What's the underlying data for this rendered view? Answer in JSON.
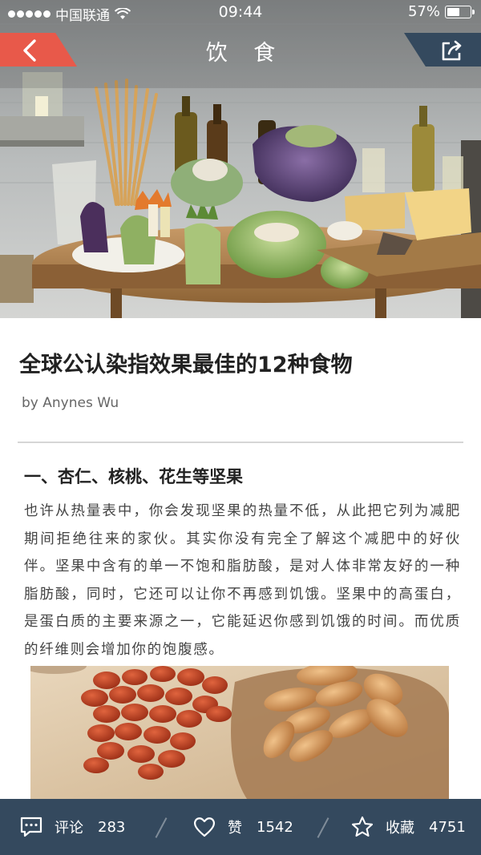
{
  "status_bar": {
    "carrier": "中国联通",
    "time": "09:44",
    "battery_percent": "57%",
    "battery_level": 0.57
  },
  "nav": {
    "title": "饮 食",
    "back_icon": "chevron-left-icon",
    "share_icon": "share-icon",
    "back_color": "#e8594a",
    "share_color": "#34495e"
  },
  "article": {
    "title": "全球公认染指效果最佳的12种食物",
    "author": "by Anynes Wu",
    "section_heading": "一、杏仁、核桃、花生等坚果",
    "body": "也许从热量表中，你会发现坚果的热量不低，从此把它列为减肥期间拒绝往来的家伙。其实你没有完全了解这个减肥中的好伙伴。坚果中含有的单一不饱和脂肪酸，是对人体非常友好的一种脂肪酸，同时，它还可以让你不再感到饥饿。坚果中的高蛋白，是蛋白质的主要来源之一，它能延迟你感到饥饿的时间。而优质的纤维则会增加你的饱腹感。"
  },
  "bottom_bar": {
    "comment": {
      "label": "评论",
      "count": "283",
      "icon": "comment-icon"
    },
    "like": {
      "label": "赞",
      "count": "1542",
      "icon": "heart-icon"
    },
    "favorite": {
      "label": "收藏",
      "count": "4751",
      "icon": "star-icon"
    },
    "background": "#34495e"
  }
}
